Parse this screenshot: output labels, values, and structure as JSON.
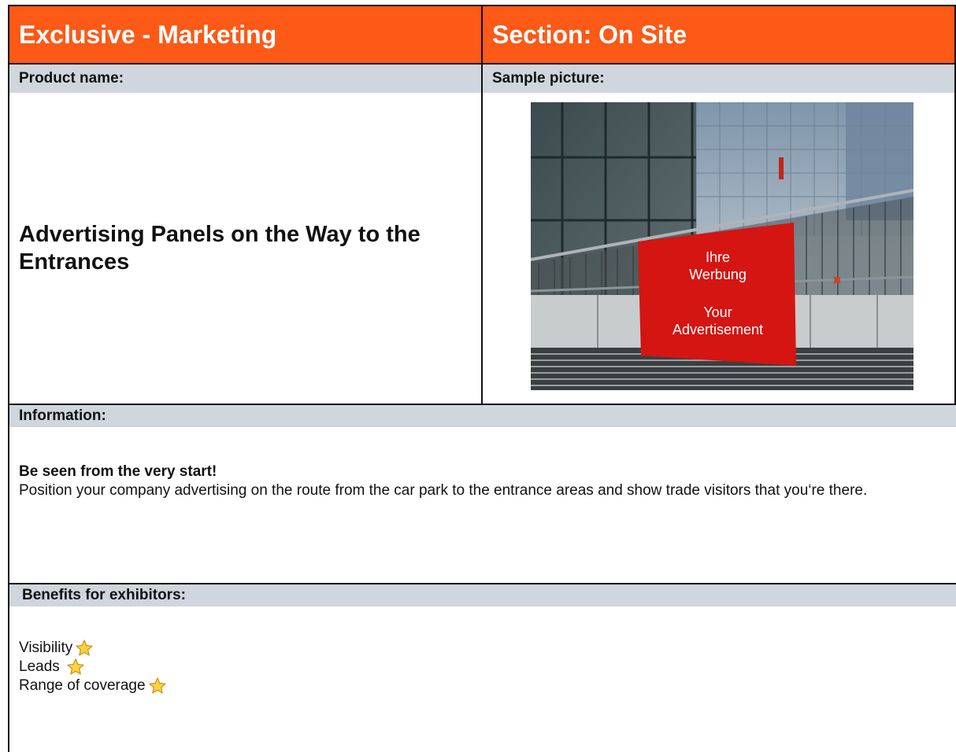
{
  "colors": {
    "header_bg": "#fd5917",
    "subheader_bg": "#cfd6dd",
    "ad_panel": "#d41512",
    "star_fill": "#ffd23f",
    "star_stroke": "#c8901a"
  },
  "header": {
    "left_title": "Exclusive - Marketing",
    "right_title": "Section: On Site"
  },
  "product": {
    "label": "Product name:",
    "name": "Advertising Panels on the Way to the Entrances"
  },
  "sample": {
    "label": "Sample picture:",
    "ad_line1": "Ihre",
    "ad_line2": "Werbung",
    "ad_line3": "Your",
    "ad_line4": "Advertisement"
  },
  "information": {
    "label": "Information:",
    "lead": "Be seen from the very start!",
    "text": "Position your company advertising on the route from the car park to the entrance areas and show trade visitors that you‘re there."
  },
  "benefits": {
    "label": "Benefits for exhibitors:",
    "items": [
      {
        "label": "Visibility",
        "icon": "star-icon"
      },
      {
        "label": "Leads",
        "icon": "star-icon"
      },
      {
        "label": "Range of coverage",
        "icon": "star-icon"
      }
    ]
  }
}
